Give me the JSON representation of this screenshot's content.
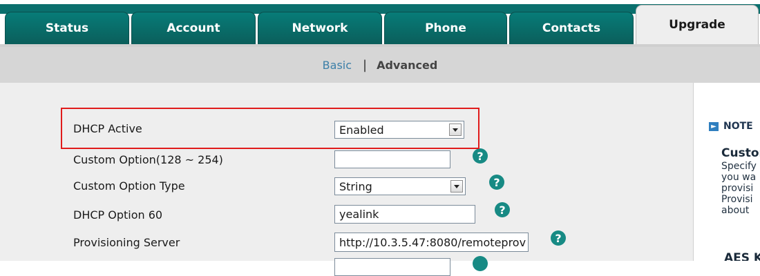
{
  "tabs": [
    {
      "label": "Status"
    },
    {
      "label": "Account"
    },
    {
      "label": "Network"
    },
    {
      "label": "Phone"
    },
    {
      "label": "Contacts"
    },
    {
      "label": "Upgrade"
    }
  ],
  "subnav": {
    "basic": "Basic",
    "separator": "|",
    "advanced": "Advanced"
  },
  "form": {
    "dhcp_active": {
      "label": "DHCP Active",
      "value": "Enabled"
    },
    "custom_option": {
      "label": "Custom Option(128 ~ 254)",
      "value": ""
    },
    "custom_option_type": {
      "label": "Custom Option Type",
      "value": "String"
    },
    "dhcp_option_60": {
      "label": "DHCP Option 60",
      "value": "yealink"
    },
    "provisioning_server": {
      "label": "Provisioning Server",
      "value": "http://10.3.5.47:8080/remoteprov"
    }
  },
  "help_glyph": "?",
  "note": {
    "title": "NOTE",
    "subtitle": "Custom",
    "body_lines": [
      "Specify",
      "you wa",
      "provisi",
      "Provisi",
      "about"
    ],
    "subtitle2": "AES K"
  },
  "colors": {
    "tab": "#0a6f6d",
    "active_tab": "#eeeeee",
    "help": "#178a84",
    "highlight": "#e01b1b",
    "link": "#3c7fa8"
  }
}
